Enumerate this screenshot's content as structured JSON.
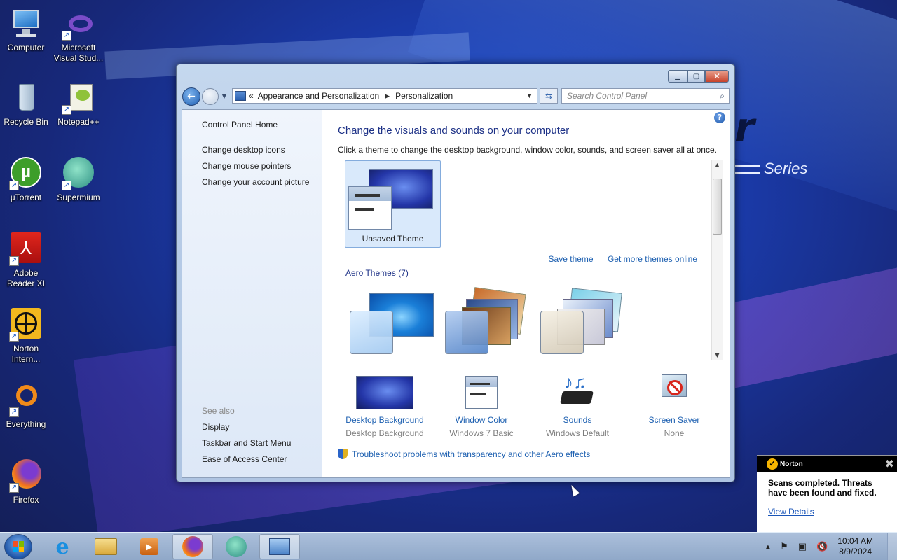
{
  "desktop": {
    "icons": [
      {
        "name": "Computer",
        "icon": "computer-icon"
      },
      {
        "name": "Microsoft Visual Stud...",
        "icon": "visual-studio-icon"
      },
      {
        "name": "Recycle Bin",
        "icon": "recycle-bin-icon"
      },
      {
        "name": "Notepad++",
        "icon": "notepadpp-icon"
      },
      {
        "name": "µTorrent",
        "icon": "utorrent-icon"
      },
      {
        "name": "Supermium",
        "icon": "supermium-icon"
      },
      {
        "name": "Adobe Reader XI",
        "icon": "adobe-reader-icon"
      },
      {
        "name": "Norton Intern...",
        "icon": "norton-icon"
      },
      {
        "name": "Everything",
        "icon": "everything-icon"
      },
      {
        "name": "Firefox",
        "icon": "firefox-icon"
      }
    ],
    "wallpaper_text": "Series"
  },
  "window": {
    "address": {
      "chevron": "«",
      "crumbs": [
        "Appearance and Personalization",
        "Personalization"
      ]
    },
    "search_placeholder": "Search Control Panel",
    "left_pane": {
      "home": "Control Panel Home",
      "links": [
        "Change desktop icons",
        "Change mouse pointers",
        "Change your account picture"
      ],
      "see_also_title": "See also",
      "see_also": [
        "Display",
        "Taskbar and Start Menu",
        "Ease of Access Center"
      ]
    },
    "heading": "Change the visuals and sounds on your computer",
    "subheading": "Click a theme to change the desktop background, window color, sounds, and screen saver all at once.",
    "themes": {
      "current": "Unsaved Theme",
      "save_link": "Save theme",
      "more_link": "Get more themes online",
      "group_title": "Aero Themes (7)"
    },
    "bottom_items": [
      {
        "title": "Desktop Background",
        "value": "Desktop Background"
      },
      {
        "title": "Window Color",
        "value": "Windows 7 Basic"
      },
      {
        "title": "Sounds",
        "value": "Windows Default"
      },
      {
        "title": "Screen Saver",
        "value": "None"
      }
    ],
    "troubleshoot_link": "Troubleshoot problems with transparency and other Aero effects"
  },
  "norton_toast": {
    "brand": "Norton",
    "message": "Scans completed. Threats have been found and fixed.",
    "link": "View Details"
  },
  "taskbar": {
    "pinned": [
      "internet-explorer-icon",
      "file-explorer-icon",
      "media-player-icon",
      "firefox-icon",
      "supermium-icon",
      "control-panel-icon"
    ],
    "time": "10:04 AM",
    "date": "8/9/2024"
  }
}
